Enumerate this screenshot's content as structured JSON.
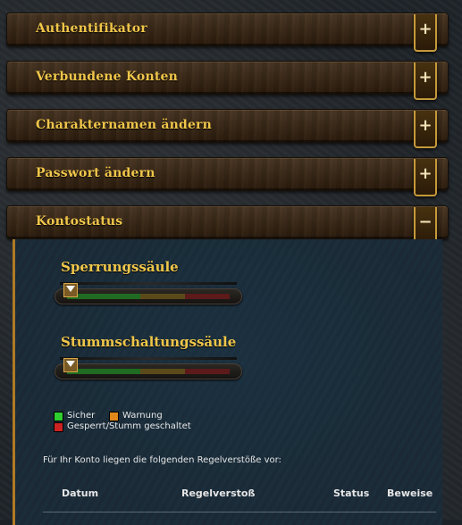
{
  "sections": [
    {
      "label": "Authentifikator",
      "toggle": "+"
    },
    {
      "label": "Verbundene Konten",
      "toggle": "+"
    },
    {
      "label": "Charakternamen ändern",
      "toggle": "+"
    },
    {
      "label": "Passwort ändern",
      "toggle": "+"
    },
    {
      "label": "Kontostatus",
      "toggle": "−"
    }
  ],
  "status": {
    "gauges": [
      {
        "title": "Sperrungssäule",
        "level": 0
      },
      {
        "title": "Stummschaltungssäule",
        "level": 0
      }
    ],
    "legend": [
      {
        "label": "Sicher",
        "color": "#2ecc2e"
      },
      {
        "label": "Warnung",
        "color": "#e0891a"
      },
      {
        "label": "Gesperrt/Stumm geschaltet",
        "color": "#cc2222"
      }
    ],
    "note": "Für Ihr Konto liegen die folgenden Regelverstöße vor:",
    "table_headers": [
      "Datum",
      "Regelverstoß",
      "Status",
      "Beweise"
    ]
  },
  "colors": {
    "accent": "#f0c64a",
    "gauge_safe": "#1f6b22",
    "gauge_warn": "#5a4a1a",
    "gauge_danger": "#5c1a1a"
  }
}
